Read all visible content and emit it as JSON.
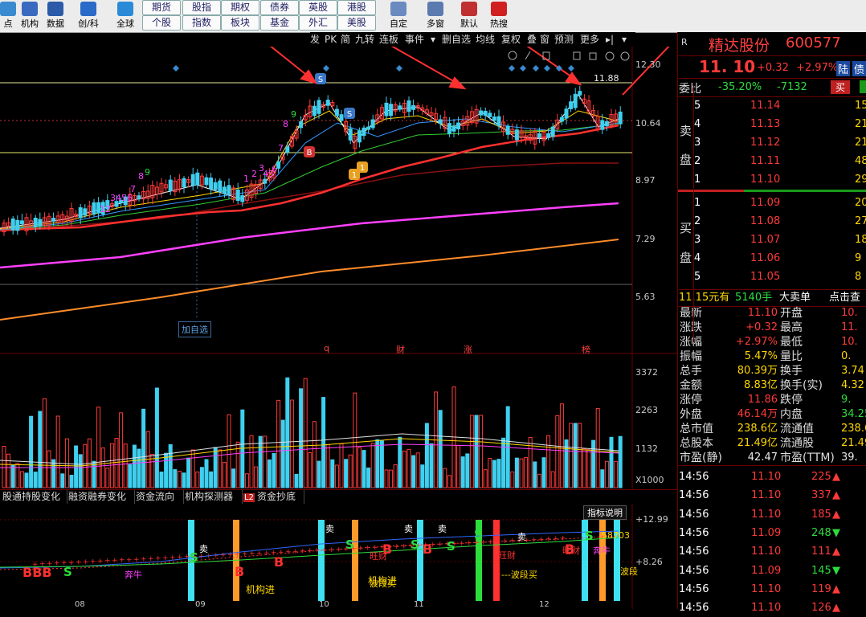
{
  "toolbar": {
    "buttons": [
      {
        "label": "点",
        "icon": "gauge-icon"
      },
      {
        "label": "机构",
        "icon": "bank-icon"
      },
      {
        "label": "数据",
        "icon": "pe-icon"
      },
      {
        "label": "创/科",
        "icon": "chuang-icon"
      },
      {
        "label": "全球",
        "icon": "globe-icon"
      },
      {
        "label": "自定",
        "icon": "edit-icon"
      },
      {
        "label": "多窗",
        "icon": "multiwindow-icon"
      },
      {
        "label": "默认",
        "icon": "home-icon"
      },
      {
        "label": "热搜",
        "icon": "hot-icon"
      }
    ],
    "market_row1": [
      "期货",
      "股指",
      "期权",
      "债券",
      "英股",
      "港股"
    ],
    "market_row2": [
      "个股",
      "指数",
      "板块",
      "基金",
      "外汇",
      "美股"
    ]
  },
  "chart_menu": [
    "发",
    "PK",
    "简",
    "九转",
    "连板",
    "事件",
    "▾",
    "删自选",
    "均线",
    "复权",
    "叠",
    "窗",
    "预测",
    "更多",
    "▸|",
    "▾"
  ],
  "price_axis": [
    "12.30",
    "10.64",
    "8.97",
    "7.29",
    "5.63"
  ],
  "price_high_marker": "11.88",
  "chart_tags": [
    "q",
    "财",
    "涨",
    "榜"
  ],
  "add_watch_label": "加自选",
  "volume_axis": [
    "3372",
    "2263",
    "1132",
    "X1000"
  ],
  "indicator_tabs": [
    "股通持股变化",
    "融资融券变化",
    "资金流向",
    "机构探测器",
    "资金抄底"
  ],
  "indicator_tab_badge": "L2",
  "indicator_panel": {
    "button": "指标说明",
    "axis": [
      "+12.99",
      "+8.26"
    ],
    "value_label": "58703",
    "texts": [
      "BBB",
      "S",
      "奔牛",
      "B",
      "卖",
      "S",
      "机构进",
      "B",
      "波段买",
      "机构进",
      "卖",
      "B",
      "S",
      "旺财",
      "卖",
      "B",
      "S",
      "S",
      "卖",
      "旺财",
      "---波段买",
      "卖",
      "S",
      "旺财",
      "B",
      "S",
      "奔牛",
      "波段"
    ]
  },
  "x_axis_months": [
    "08",
    "09",
    "10",
    "11",
    "12"
  ],
  "quote": {
    "prefix": "R",
    "name": "精达股份",
    "code": "600577",
    "price": "11. 10",
    "change": "+0.32",
    "change_pct": "+2.97%",
    "tag": "陆",
    "tag2": "债",
    "weibi_label": "委比",
    "weibi_pct": "-35.20%",
    "weibi_diff": "-7132",
    "buy_btn": "买",
    "sell_side_label": [
      "卖",
      "盘"
    ],
    "buy_side_label": [
      "买",
      "盘"
    ],
    "asks": [
      {
        "lvl": "5",
        "price": "11.14",
        "vol": "15"
      },
      {
        "lvl": "4",
        "price": "11.13",
        "vol": "21"
      },
      {
        "lvl": "3",
        "price": "11.12",
        "vol": "21"
      },
      {
        "lvl": "2",
        "price": "11.11",
        "vol": "48"
      },
      {
        "lvl": "1",
        "price": "11.10",
        "vol": "29"
      }
    ],
    "bids": [
      {
        "lvl": "1",
        "price": "11.09",
        "vol": "20"
      },
      {
        "lvl": "2",
        "price": "11.08",
        "vol": "27"
      },
      {
        "lvl": "3",
        "price": "11.07",
        "vol": "18"
      },
      {
        "lvl": "4",
        "price": "11.06",
        "vol": "9"
      },
      {
        "lvl": "5",
        "price": "11.05",
        "vol": "8"
      }
    ],
    "big_order": {
      "price": "11.15元有",
      "vol": "5140手",
      "type": "大卖单",
      "link": "点击查"
    },
    "stats": [
      {
        "l1": "最新",
        "v1": "11.10",
        "c1": "red",
        "l2": "开盘",
        "v2": "10.",
        "c2": "red"
      },
      {
        "l1": "涨跌",
        "v1": "+0.32",
        "c1": "red",
        "l2": "最高",
        "v2": "11.",
        "c2": "red"
      },
      {
        "l1": "涨幅",
        "v1": "+2.97%",
        "c1": "red",
        "l2": "最低",
        "v2": "10.",
        "c2": "red"
      },
      {
        "l1": "振幅",
        "v1": "5.47%",
        "c1": "yel",
        "l2": "量比",
        "v2": "0.",
        "c2": "yel"
      },
      {
        "l1": "总手",
        "v1": "80.39万",
        "c1": "yel",
        "l2": "换手",
        "v2": "3.74",
        "c2": "yel"
      },
      {
        "l1": "金额",
        "v1": "8.83亿",
        "c1": "yel",
        "l2": "换手(实)",
        "v2": "4.32",
        "c2": "yel"
      },
      {
        "l1": "涨停",
        "v1": "11.86",
        "c1": "red",
        "l2": "跌停",
        "v2": "9.",
        "c2": "grn"
      },
      {
        "l1": "外盘",
        "v1": "46.14万",
        "c1": "red",
        "l2": "内盘",
        "v2": "34.25",
        "c2": "grn"
      },
      {
        "l1": "总市值",
        "v1": "238.6亿",
        "c1": "yel",
        "l2": "流通值",
        "v2": "238.6",
        "c2": "yel"
      },
      {
        "l1": "总股本",
        "v1": "21.49亿",
        "c1": "yel",
        "l2": "流通股",
        "v2": "21.49",
        "c2": "yel"
      },
      {
        "l1": "市盈(静)",
        "v1": "42.47",
        "c1": "wht",
        "l2": "市盈(TTM)",
        "v2": "39.",
        "c2": "wht"
      }
    ],
    "trades": [
      {
        "time": "14:56",
        "price": "11.10",
        "vol": "225",
        "dir": "up"
      },
      {
        "time": "14:56",
        "price": "11.10",
        "vol": "337",
        "dir": "up"
      },
      {
        "time": "14:56",
        "price": "11.10",
        "vol": "185",
        "dir": "up"
      },
      {
        "time": "14:56",
        "price": "11.09",
        "vol": "248",
        "dir": "down"
      },
      {
        "time": "14:56",
        "price": "11.10",
        "vol": "111",
        "dir": "up"
      },
      {
        "time": "14:56",
        "price": "11.09",
        "vol": "145",
        "dir": "down"
      },
      {
        "time": "14:56",
        "price": "11.10",
        "vol": "119",
        "dir": "up"
      },
      {
        "time": "14:56",
        "price": "11.10",
        "vol": "126",
        "dir": "up"
      }
    ]
  },
  "colors": {
    "up": "#ff3a3a",
    "down": "#2ddc3d",
    "ma5": "#ffffff",
    "ma10": "#ffd700",
    "ma20": "#ff40ff",
    "ma60": "#00ff00",
    "bg": "#000000",
    "grid": "#6a0000"
  }
}
